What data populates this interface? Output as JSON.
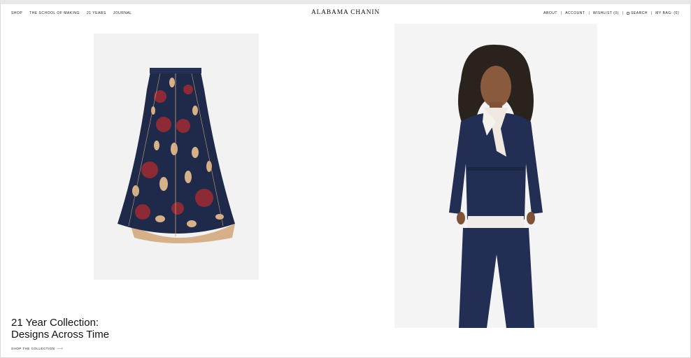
{
  "header": {
    "left_nav": [
      "SHOP",
      "THE SCHOOL OF MAKING",
      "21 YEARS",
      "JOURNAL"
    ],
    "logo": "ALABAMA CHANIN",
    "right_nav": {
      "about": "ABOUT",
      "account": "ACCOUNT",
      "wishlist": "WISHLIST (0)",
      "search": "SEARCH",
      "bag": "MY BAG: (0)"
    },
    "separator": "|"
  },
  "products": [
    {
      "name": "skirt-image",
      "icon": "skirt-photo"
    },
    {
      "name": "model-image",
      "icon": "model-photo"
    }
  ],
  "hero": {
    "title_line1": "21 Year Collection:",
    "title_line2": "Designs Across Time",
    "cta_label": "SHOP THE COLLECTION",
    "cta_icon": "arrow-right-icon"
  },
  "colors": {
    "navy": "#1f2a4a",
    "rose": "#8c2a35",
    "tan": "#d6b088",
    "panel_bg": "#f2f2f2"
  }
}
